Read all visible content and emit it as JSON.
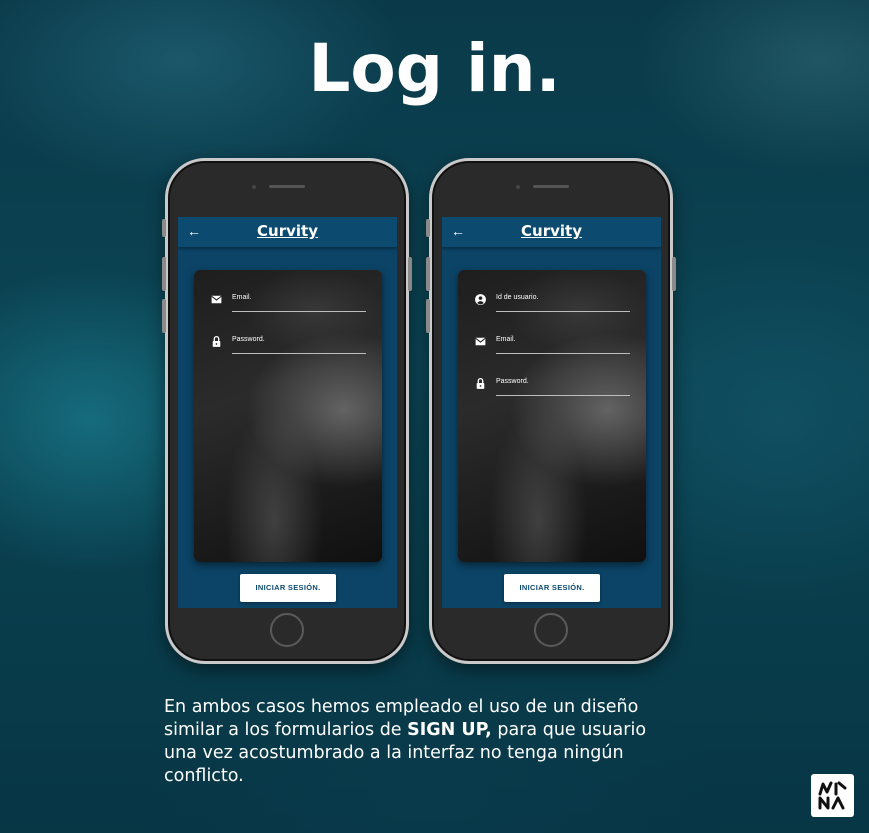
{
  "heading": "Log in.",
  "phones": [
    {
      "header_title": "Curvity",
      "fields": [
        {
          "icon": "mail-icon",
          "label": "Email."
        },
        {
          "icon": "lock-icon",
          "label": "Password."
        }
      ],
      "button_label": "INICIAR SESIÓN."
    },
    {
      "header_title": "Curvity",
      "fields": [
        {
          "icon": "user-circle-icon",
          "label": "Id de usuario."
        },
        {
          "icon": "mail-icon",
          "label": "Email."
        },
        {
          "icon": "lock-icon",
          "label": "Password."
        }
      ],
      "button_label": "INICIAR SESIÓN."
    }
  ],
  "caption": {
    "part1": "En ambos casos hemos empleado el uso de un diseño similar a los formularios de ",
    "bold": "SIGN UP,",
    "part2": " para que usuario una vez acostumbrado a la interfaz no tenga ningún conflicto."
  },
  "logo_icon": "mina-logo",
  "colors": {
    "screen_bg": "#0c4467",
    "header_bg": "#0d4a6f",
    "button_text": "#0d4a6f",
    "phone_frame": "#c9c9c9"
  }
}
